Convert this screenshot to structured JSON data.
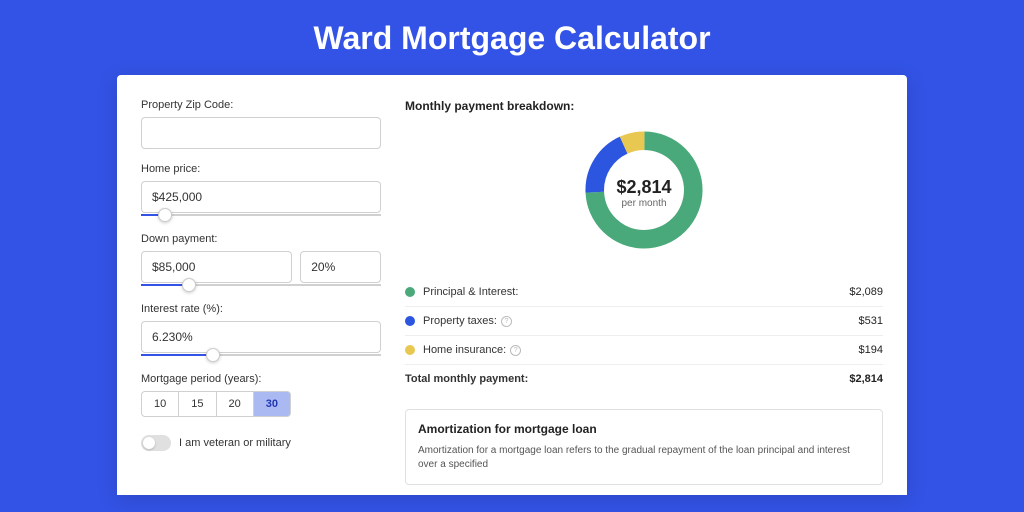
{
  "title": "Ward Mortgage Calculator",
  "form": {
    "zip_label": "Property Zip Code:",
    "zip_value": "",
    "price_label": "Home price:",
    "price_value": "$425,000",
    "price_slider_pct": 10,
    "down_label": "Down payment:",
    "down_value": "$85,000",
    "down_pct": "20%",
    "down_slider_pct": 20,
    "rate_label": "Interest rate (%):",
    "rate_value": "6.230%",
    "rate_slider_pct": 30,
    "period_label": "Mortgage period (years):",
    "periods": [
      "10",
      "15",
      "20",
      "30"
    ],
    "period_active": "30",
    "vet_label": "I am veteran or military"
  },
  "breakdown": {
    "title": "Monthly payment breakdown:",
    "center_amount": "$2,814",
    "center_sub": "per month",
    "items": [
      {
        "label": "Principal & Interest:",
        "value": "$2,089",
        "color": "#4aa97a",
        "info": false
      },
      {
        "label": "Property taxes:",
        "value": "$531",
        "color": "#2c55e0",
        "info": true
      },
      {
        "label": "Home insurance:",
        "value": "$194",
        "color": "#e8c851",
        "info": true
      }
    ],
    "total_label": "Total monthly payment:",
    "total_value": "$2,814"
  },
  "amort": {
    "title": "Amortization for mortgage loan",
    "body": "Amortization for a mortgage loan refers to the gradual repayment of the loan principal and interest over a specified"
  },
  "chart_data": {
    "type": "pie",
    "title": "Monthly payment breakdown",
    "series": [
      {
        "name": "Principal & Interest",
        "value": 2089,
        "color": "#4aa97a"
      },
      {
        "name": "Property taxes",
        "value": 531,
        "color": "#2c55e0"
      },
      {
        "name": "Home insurance",
        "value": 194,
        "color": "#e8c851"
      }
    ],
    "total": 2814,
    "unit": "USD/month"
  }
}
